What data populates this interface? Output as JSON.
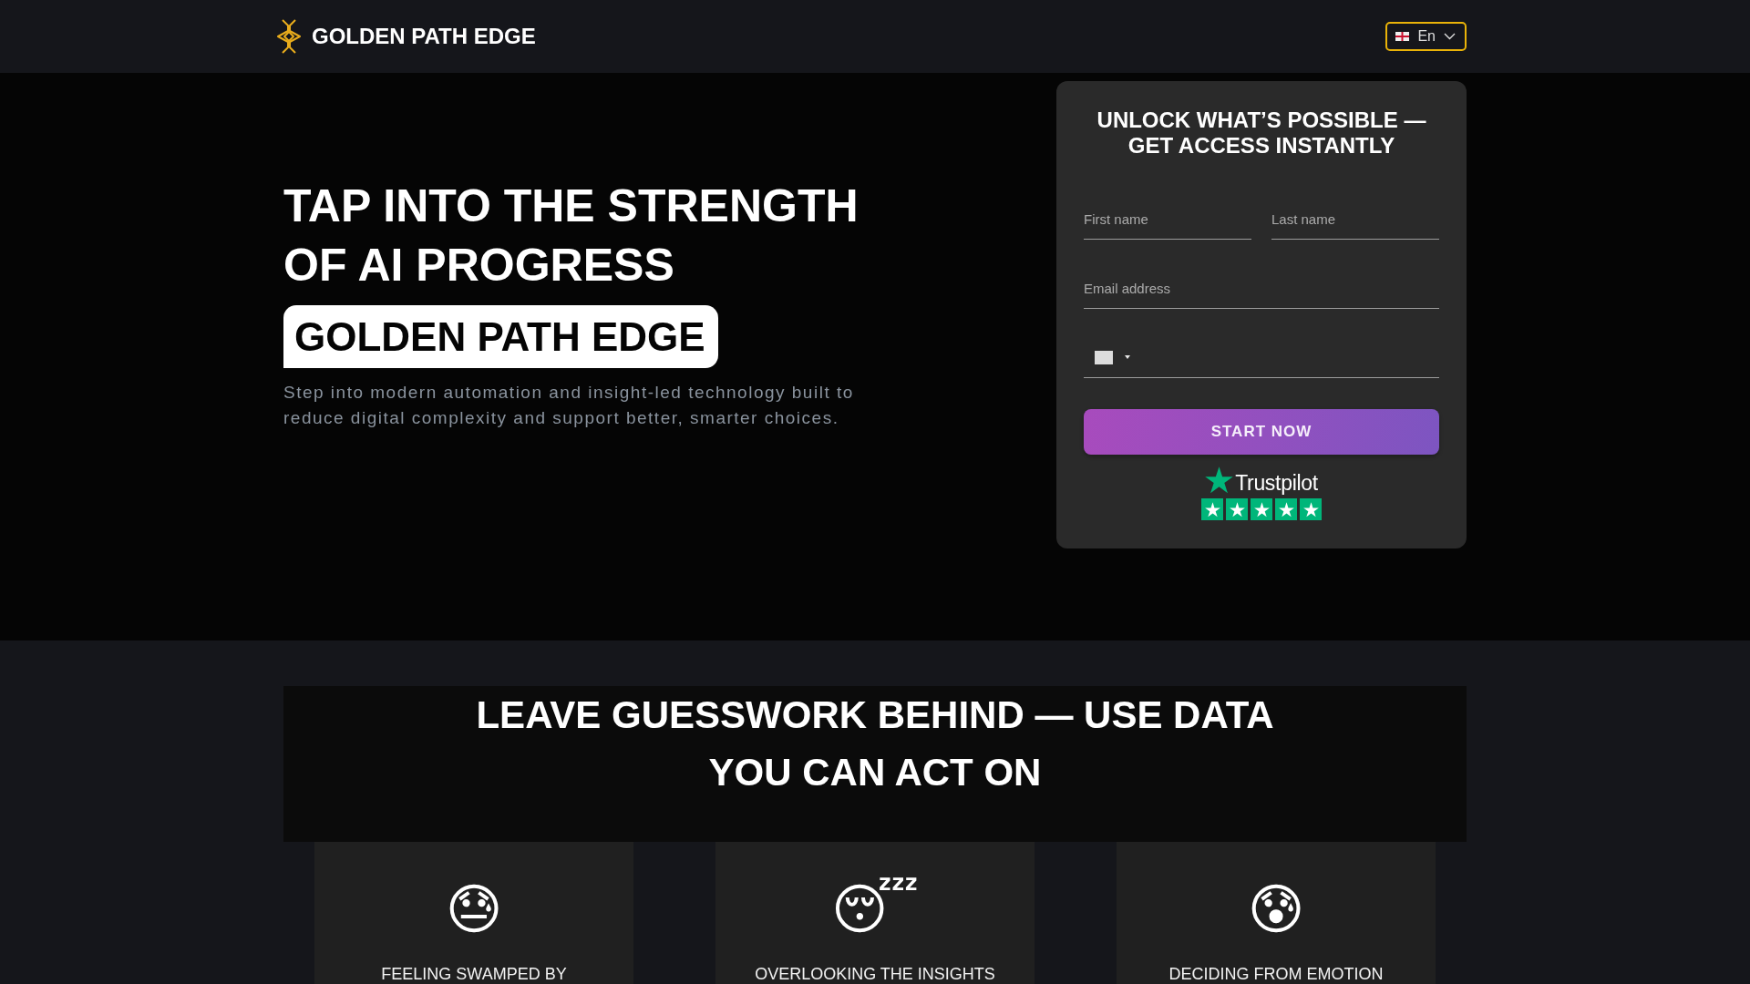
{
  "header": {
    "logo_text": "GOLDEN PATH EDGE",
    "language": {
      "label": "En"
    }
  },
  "hero": {
    "title": "TAP INTO THE STRENGTH OF AI PROGRESS",
    "highlight": "GOLDEN PATH EDGE",
    "description": "Step into modern automation and insight-led technology built to reduce digital complexity and support better, smarter choices."
  },
  "form": {
    "title": "UNLOCK WHAT’S POSSIBLE — GET ACCESS INSTANTLY",
    "fields": [
      {
        "kind": "name",
        "placeholder": "First name"
      },
      {
        "kind": "name",
        "placeholder": "Last name"
      },
      {
        "kind": "email",
        "placeholder": "Email address"
      },
      {
        "kind": "phone"
      }
    ],
    "submit": "START NOW",
    "trustpilot": {
      "label": "Trustpilot",
      "stars": 5
    }
  },
  "problems": {
    "title": "LEAVE GUESSWORK BEHIND — USE DATA YOU CAN ACT ON",
    "cards": [
      {
        "icon": "😓",
        "title": "FEELING SWAMPED BY"
      },
      {
        "icon": "😴",
        "title": "OVERLOOKING THE INSIGHTS"
      },
      {
        "icon": "😰",
        "title": "DECIDING FROM EMOTION"
      }
    ]
  }
}
